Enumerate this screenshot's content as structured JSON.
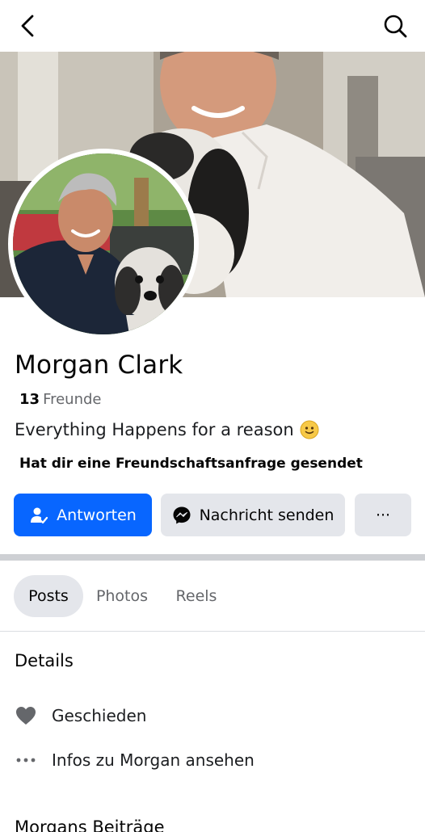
{
  "topbar": {
    "back_icon": "back-arrow-icon",
    "search_icon": "search-icon"
  },
  "profile": {
    "name": "Morgan Clark",
    "friends_count": "13",
    "friends_label": "Freunde",
    "bio": "Everything Happens for a reason",
    "bio_emoji": "slightly-smiling-face-icon",
    "request_text": "Hat dir eine Freundschaftsanfrage gesendet"
  },
  "actions": {
    "respond_label": "Antworten",
    "message_label": "Nachricht senden",
    "more_label": "···",
    "primary_color": "#0866ff"
  },
  "tabs": [
    {
      "label": "Posts",
      "active": true
    },
    {
      "label": "Photos",
      "active": false
    },
    {
      "label": "Reels",
      "active": false
    }
  ],
  "details": {
    "title": "Details",
    "items": [
      {
        "icon": "heart-icon",
        "label": "Geschieden"
      },
      {
        "icon": "more-dots-icon",
        "label": "Infos zu Morgan ansehen"
      }
    ]
  },
  "posts_section": {
    "title": "Morgans Beiträge"
  }
}
